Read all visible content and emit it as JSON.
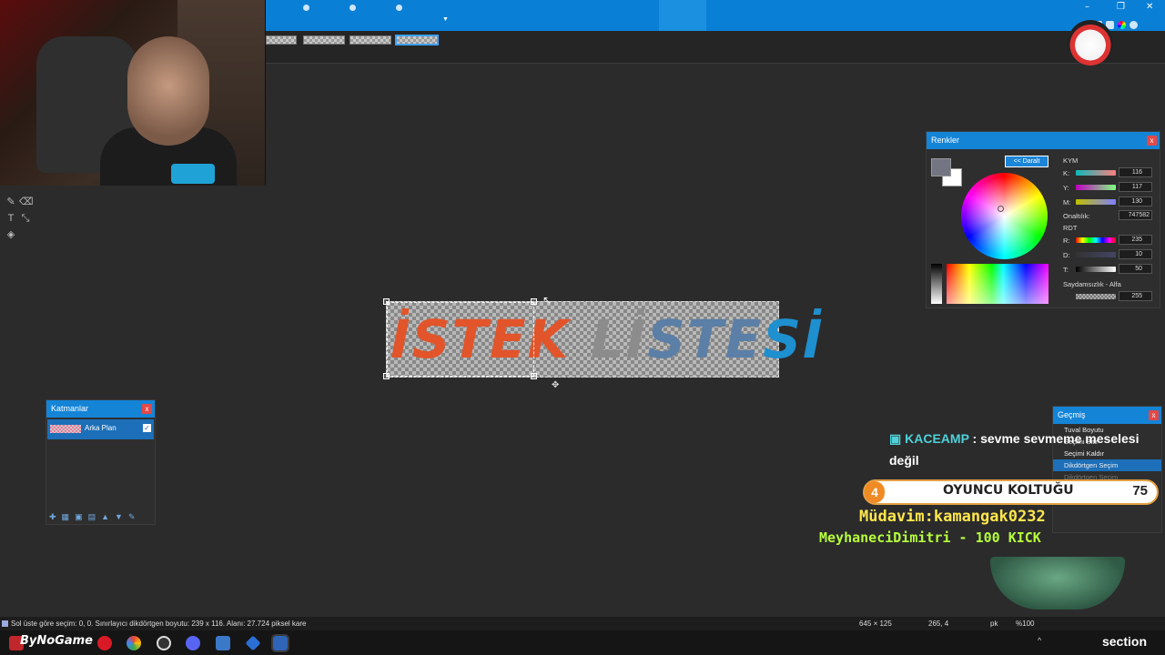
{
  "colors": {
    "title": "Renkler",
    "collapse_label": "<< Daralt",
    "kym_label": "KYM",
    "k_label": "K:",
    "k_value": "116",
    "y_label": "Y:",
    "y_value": "117",
    "m_label": "M:",
    "m_value": "130",
    "hex_label": "Onaltılık:",
    "hex_value": "747582",
    "rdt_label": "RDT",
    "r_label": "R:",
    "r_value": "235",
    "d_label": "D:",
    "d_value": "10",
    "t_label": "T:",
    "t_value": "50",
    "alpha_label": "Saydamsızlık - Alfa",
    "alpha_value": "255",
    "primary_color": "#747582",
    "secondary_color": "#ffffff"
  },
  "canvas": {
    "word1": "İSTEK",
    "word2a": "Lİ",
    "word2b": "STE",
    "word2c": "Sİ"
  },
  "layers": {
    "title": "Katmanlar",
    "close": "x",
    "items": [
      {
        "name": "Arka Plan",
        "visible_mark": "✓"
      }
    ]
  },
  "history": {
    "title": "Geçmiş",
    "close": "x",
    "items": [
      {
        "label": "Tuval Boyutu"
      },
      {
        "label": "Seçimi Bitir"
      },
      {
        "label": "Seçimi Kaldır"
      },
      {
        "label": "Dikdörtgen Seçim"
      },
      {
        "label": "Dikdörtgen Seçim"
      }
    ]
  },
  "chat": {
    "user": "KACEAMP",
    "message": ": sevme sevmeme meselesi değil"
  },
  "overlay": {
    "seat_number": "4",
    "seat_label": "OYUNCU KOLTUĞU",
    "seat_count": "75",
    "ticker1": "Müdavim:kamangak0232",
    "ticker2": "MeyhaneciDimitri - 100 KICK"
  },
  "status": {
    "selection_info": "Sol üste göre seçim: 0, 0. Sınırlayıcı dikdörtgen boyutu: 239 x 116. Alanı: 27.724 piksel kare",
    "image_size": "645 × 125",
    "cursor_pos": "265, 4",
    "unit": "pk",
    "zoom": "%100"
  },
  "taskbar": {
    "logo_text": "ByNoGame",
    "brand_text": "section"
  },
  "window_controls": {
    "minimize": "–",
    "restore": "❐",
    "close": "✕"
  }
}
